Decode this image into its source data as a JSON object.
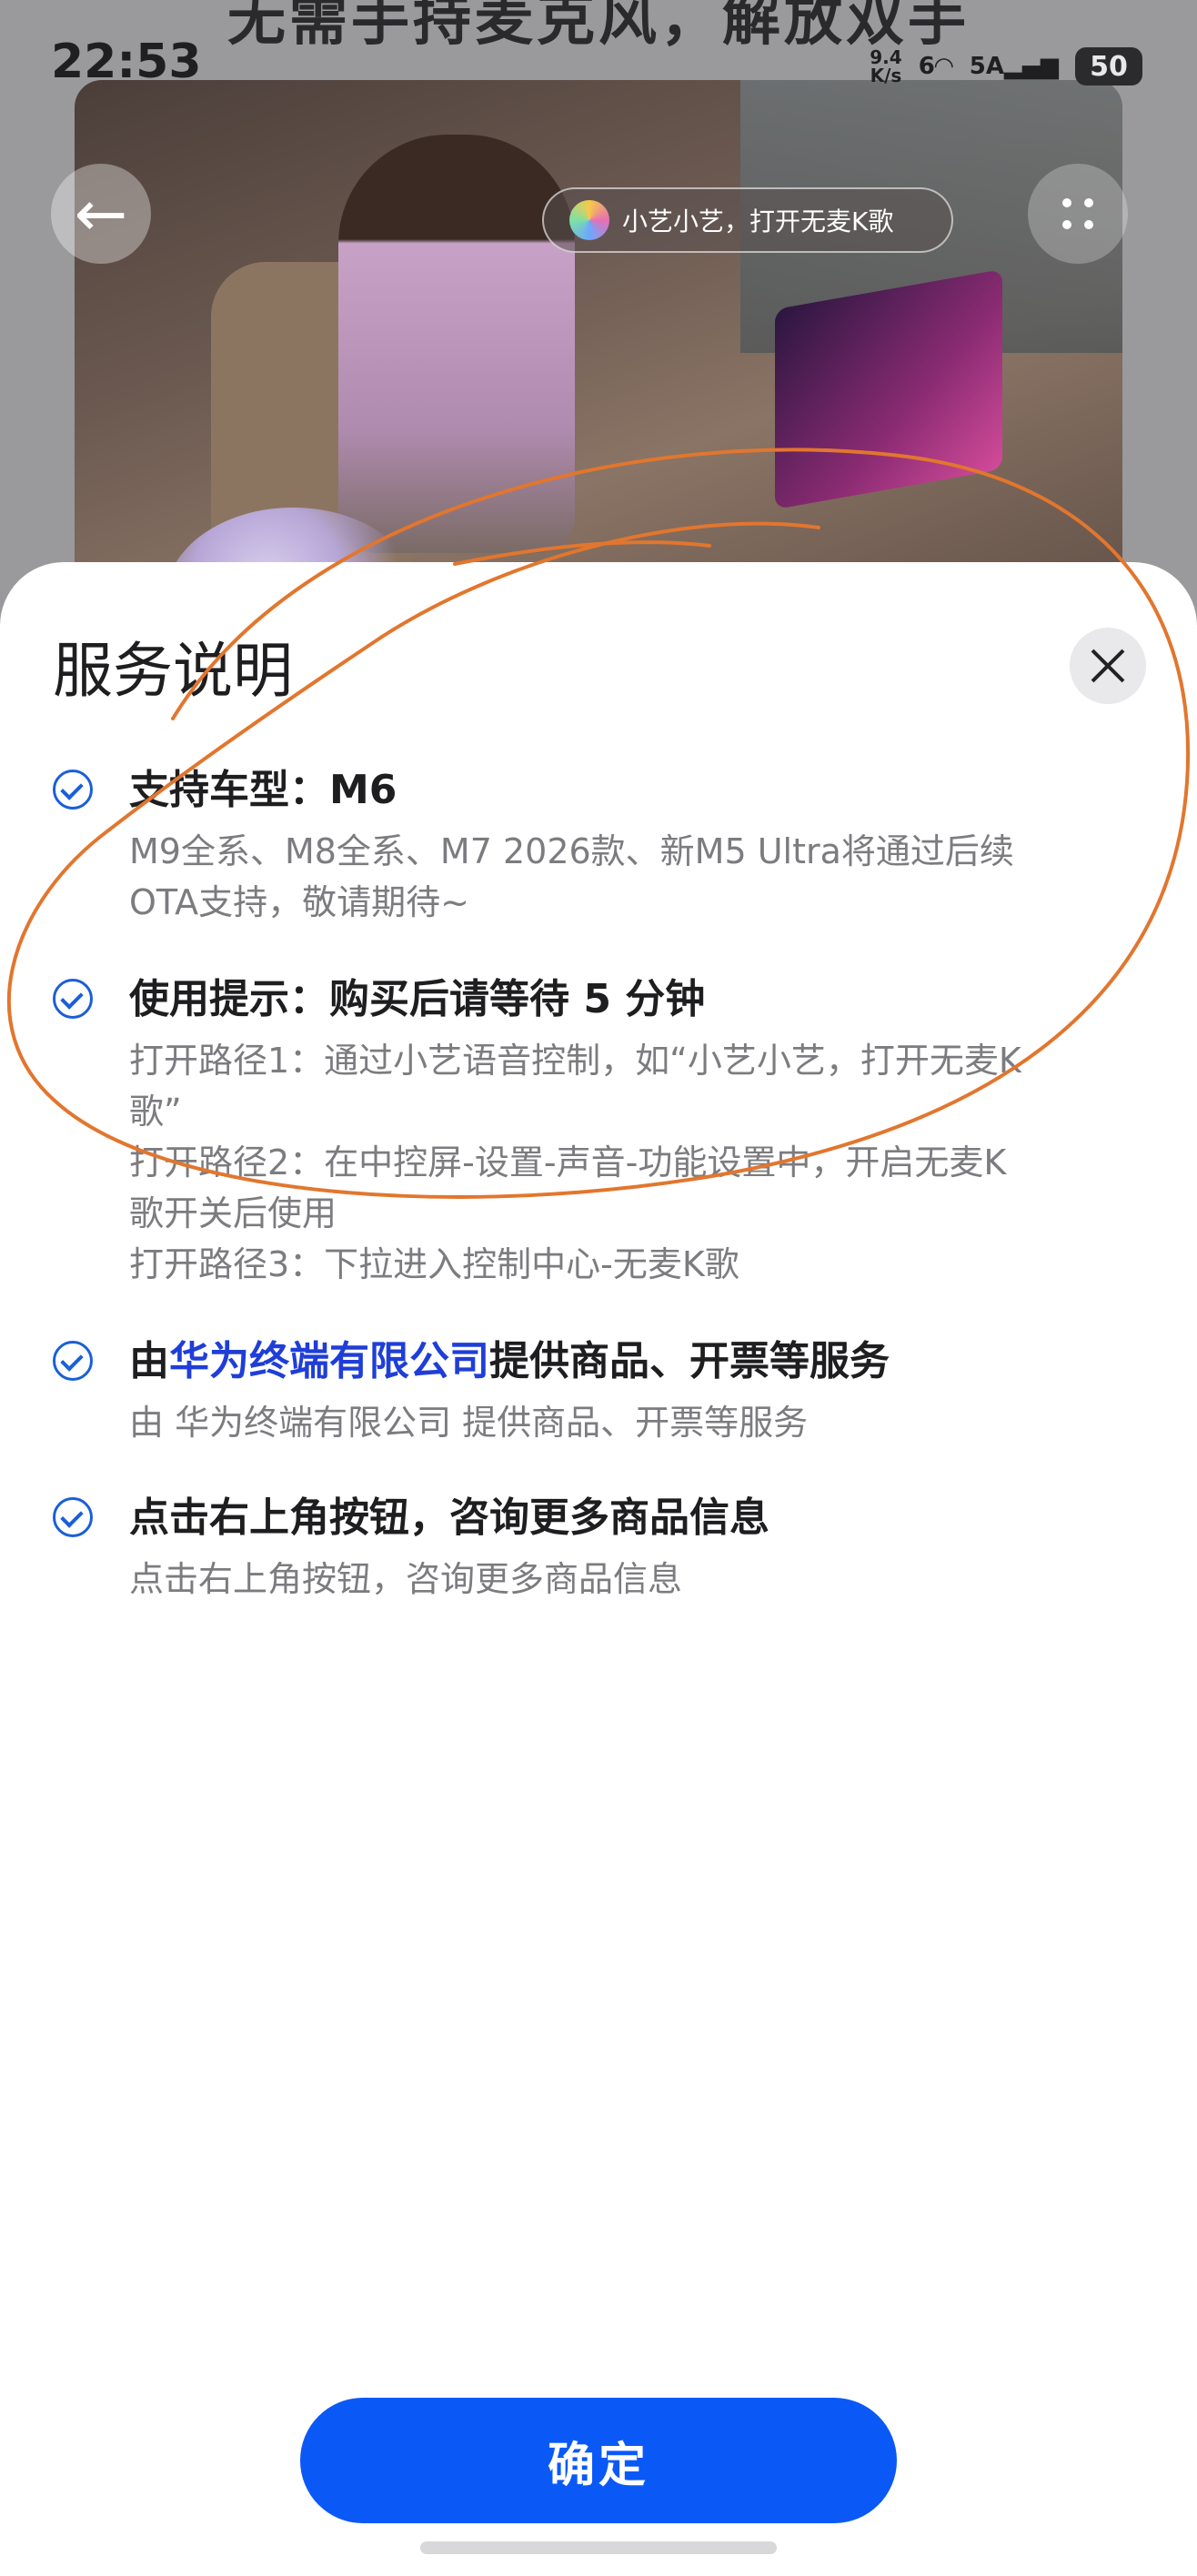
{
  "background": {
    "headline": "无需手持麦克风，解放双手",
    "voice_prompt": "小艺小艺，打开无麦K歌"
  },
  "status_bar": {
    "time": "22:53",
    "net_speed": "9.4",
    "net_unit": "K/s",
    "wifi_label": "6",
    "cell_label": "5A",
    "battery": "50"
  },
  "sheet": {
    "title": "服务说明",
    "items": [
      {
        "title": "支持车型：M6",
        "desc_lines": [
          "M9全系、M8全系、M7 2026款、新M5 Ultra将通过后续",
          "OTA支持，敬请期待~"
        ]
      },
      {
        "title": "使用提示：购买后请等待 5 分钟",
        "desc_lines": [
          "打开路径1：通过小艺语音控制，如“小艺小艺，打开无麦K",
          "歌”",
          "打开路径2：在中控屏-设置-声音-功能设置中，开启无麦K",
          "歌开关后使用",
          "打开路径3：下拉进入控制中心-无麦K歌"
        ]
      },
      {
        "title_prefix": "由",
        "title_link": "华为终端有限公司",
        "title_suffix": "提供商品、开票等服务",
        "desc_lines": [
          "由 华为终端有限公司 提供商品、开票等服务"
        ]
      },
      {
        "title": "点击右上角按钮，咨询更多商品信息",
        "desc_lines": [
          "点击右上角按钮，咨询更多商品信息"
        ]
      }
    ],
    "confirm_label": "确定"
  },
  "colors": {
    "accent": "#0a59f7",
    "link": "#1f3ed8",
    "annotation": "#e2762e"
  },
  "icons": [
    "back-arrow-icon",
    "more-dots-icon",
    "close-icon",
    "check-circle-icon",
    "wifi-icon",
    "signal-icon",
    "battery-icon"
  ]
}
